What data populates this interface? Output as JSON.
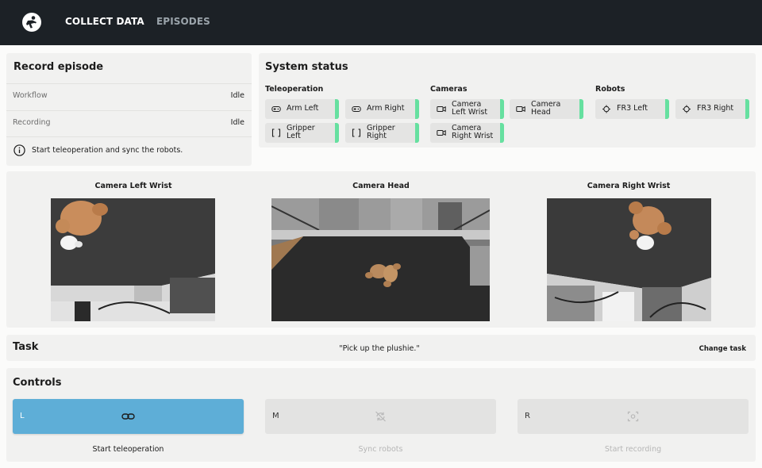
{
  "nav": {
    "active_tab": "COLLECT DATA",
    "other_tab": "EPISODES"
  },
  "record": {
    "title": "Record episode",
    "rows": [
      {
        "label": "Workflow",
        "value": "Idle"
      },
      {
        "label": "Recording",
        "value": "Idle"
      }
    ],
    "info": "Start teleoperation and sync the robots."
  },
  "status": {
    "title": "System status",
    "groups": [
      {
        "label": "Teleoperation",
        "items": [
          {
            "label": "Arm Left",
            "icon": "gamepad-icon"
          },
          {
            "label": "Arm Right",
            "icon": "gamepad-icon"
          },
          {
            "label": "Gripper Left",
            "icon": "gripper-icon"
          },
          {
            "label": "Gripper Right",
            "icon": "gripper-icon"
          }
        ]
      },
      {
        "label": "Cameras",
        "items": [
          {
            "label": "Camera Left Wrist",
            "icon": "camera-icon"
          },
          {
            "label": "Camera Head",
            "icon": "camera-icon"
          },
          {
            "label": "Camera Right Wrist",
            "icon": "camera-icon"
          }
        ]
      },
      {
        "label": "Robots",
        "items": [
          {
            "label": "FR3 Left",
            "icon": "robot-arm-icon"
          },
          {
            "label": "FR3 Right",
            "icon": "robot-arm-icon"
          }
        ]
      }
    ],
    "ok_color": "#66e0a0"
  },
  "cameras": [
    {
      "title": "Camera Left Wrist"
    },
    {
      "title": "Camera Head"
    },
    {
      "title": "Camera Right Wrist"
    }
  ],
  "task": {
    "title": "Task",
    "text": "\"Pick up the plushie.\"",
    "change_label": "Change task"
  },
  "controls": {
    "title": "Controls",
    "accent_color": "#5eaed7",
    "buttons": [
      {
        "key": "L",
        "label": "Start teleoperation",
        "icon": "link-icon",
        "enabled": true
      },
      {
        "key": "M",
        "label": "Sync robots",
        "icon": "sync-off-icon",
        "enabled": false
      },
      {
        "key": "R",
        "label": "Start recording",
        "icon": "record-icon",
        "enabled": false
      }
    ]
  }
}
